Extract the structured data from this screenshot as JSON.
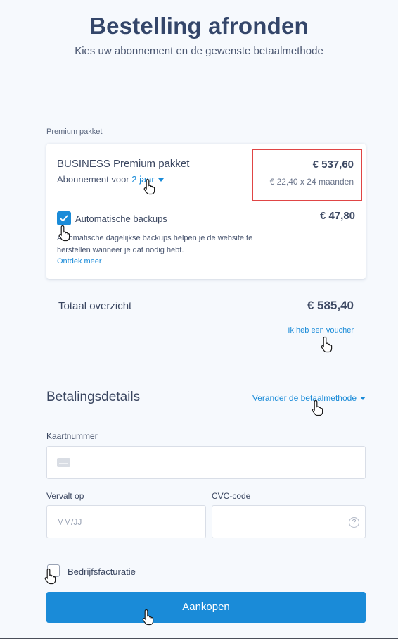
{
  "header": {
    "title": "Bestelling afronden",
    "subtitle": "Kies uw abonnement en de gewenste betaalmethode"
  },
  "package": {
    "section_label": "Premium pakket",
    "name": "BUSINESS Premium pakket",
    "period_prefix": "Abonnement voor ",
    "period_value": "2 jaar",
    "price": "€ 537,60",
    "price_breakdown": "€ 22,40 x 24 maanden",
    "highlight_color": "#e04545"
  },
  "backups": {
    "title": "Automatische backups",
    "checked": true,
    "price": "€ 47,80",
    "description": "Automatische dagelijkse backups helpen je de website te herstellen wanneer je dat nodig hebt.",
    "link": "Ontdek meer"
  },
  "summary": {
    "label": "Totaal overzicht",
    "total": "€ 585,40",
    "voucher_link": "Ik heb een voucher"
  },
  "payment": {
    "title": "Betalingsdetails",
    "change_method": "Verander de betaalmethode",
    "card_number_label": "Kaartnummer",
    "card_number_value": "",
    "expiry_label": "Vervalt op",
    "expiry_placeholder": "MM/JJ",
    "cvc_label": "CVC-code",
    "cvc_value": "",
    "help_icon": "question-circle-icon"
  },
  "company": {
    "label": "Bedrijfsfacturatie",
    "checked": false
  },
  "buy_button": {
    "label": "Aankopen"
  },
  "colors": {
    "accent": "#1a8bd8",
    "title": "#34466a",
    "background": "#f6f9fd"
  }
}
